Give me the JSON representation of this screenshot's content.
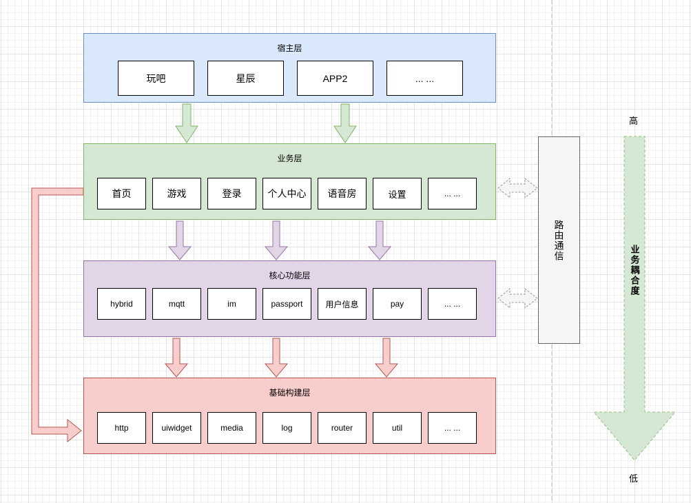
{
  "diagram": {
    "layers": [
      {
        "id": "host",
        "title": "宿主层",
        "fill": "#dae8fc",
        "stroke": "#6c8ebf",
        "modules": [
          "玩吧",
          "星辰",
          "APP2",
          "... ..."
        ]
      },
      {
        "id": "business",
        "title": "业务层",
        "fill": "#d5e8d4",
        "stroke": "#82b366",
        "modules": [
          "首页",
          "游戏",
          "登录",
          "个人中心",
          "语音房",
          "设置",
          "... ..."
        ]
      },
      {
        "id": "core",
        "title": "核心功能层",
        "fill": "#e1d5e7",
        "stroke": "#9673a6",
        "modules": [
          "hybrid",
          "mqtt",
          "im",
          "passport",
          "用户信息",
          "pay",
          "... ..."
        ]
      },
      {
        "id": "base",
        "title": "基础构建层",
        "fill": "#f8cecc",
        "stroke": "#b85450",
        "modules": [
          "http",
          "uiwidget",
          "media",
          "log",
          "router",
          "util",
          "... ..."
        ]
      }
    ],
    "router": {
      "label": "路由通信",
      "fill": "#f5f5f5",
      "stroke": "#666666",
      "connected_layers": [
        "business",
        "core"
      ]
    },
    "coupling_axis": {
      "label": "业务耦合度",
      "high_label": "高",
      "low_label": "低",
      "fill": "#d5e8d4",
      "stroke": "#82b366"
    },
    "edges": [
      {
        "from": "host",
        "to": "business",
        "count": 2,
        "color": "green"
      },
      {
        "from": "business",
        "to": "core",
        "count": 3,
        "color": "purple"
      },
      {
        "from": "core",
        "to": "base",
        "count": 3,
        "color": "red"
      },
      {
        "from": "business",
        "to": "base",
        "count": 1,
        "color": "red",
        "style": "elbow-left"
      }
    ]
  }
}
